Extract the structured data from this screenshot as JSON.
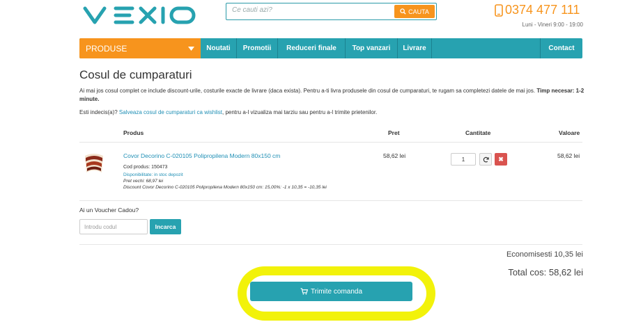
{
  "header": {
    "logo_text": "vexio",
    "search_placeholder": "Ce cauti azi?",
    "search_button": "CAUTA",
    "phone": "0374 477 111",
    "hours": "Luni - Vineri 9:00 - 19:00"
  },
  "nav": {
    "produse": "PRODUSE",
    "items": [
      "Noutati",
      "Promotii",
      "Reduceri finale",
      "Top vanzari",
      "Livrare"
    ],
    "contact": "Contact"
  },
  "page": {
    "title": "Cosul de cumparaturi",
    "intro": "Ai mai jos cosul complet ce include discount-urile, costurile exacte de livrare (daca exista). Pentru a-ti livra produsele din cosul de cumparaturi, te rugam sa completezi datele de mai jos.",
    "time_label": "Timp necesar:",
    "time_value": "1-2 minute",
    "wish_prefix": "Esti indecis(a)?",
    "wish_link": "Salveaza cosul de cumparaturi ca wishlist",
    "wish_suffix": ", pentru a-l vizualiza mai tarziu sau pentru a-l trimite prietenilor."
  },
  "table": {
    "headers": {
      "product": "Produs",
      "price": "Pret",
      "quantity": "Cantitate",
      "value": "Valoare"
    },
    "row": {
      "name": "Covor Decorino C-020105 Polipropilena Modern 80x150 cm",
      "code": "Cod produs: 150473",
      "availability": "Disponibilitate: in stoc depozit",
      "old_price": "Pret vechi: 68,97 lei",
      "discount": "Discount Covor Decorino C-020105 Polipropilena Modern 80x150 cm: 15,00%: -1 x 10,35 = -10,35 lei",
      "price": "58,62 lei",
      "quantity": "1",
      "value": "58,62 lei"
    }
  },
  "voucher": {
    "label": "Ai un Voucher Cadou?",
    "placeholder": "Introdu codul",
    "button": "Incarca"
  },
  "summary": {
    "savings": "Economisesti 10,35 lei",
    "total": "Total cos: 58,62 lei"
  },
  "submit": {
    "label": "Trimite comanda"
  },
  "colors": {
    "orange": "#f7941d",
    "teal": "#27a2b0",
    "highlight": "#f2f20a",
    "link": "#1f8fb5",
    "danger": "#d9534f"
  }
}
